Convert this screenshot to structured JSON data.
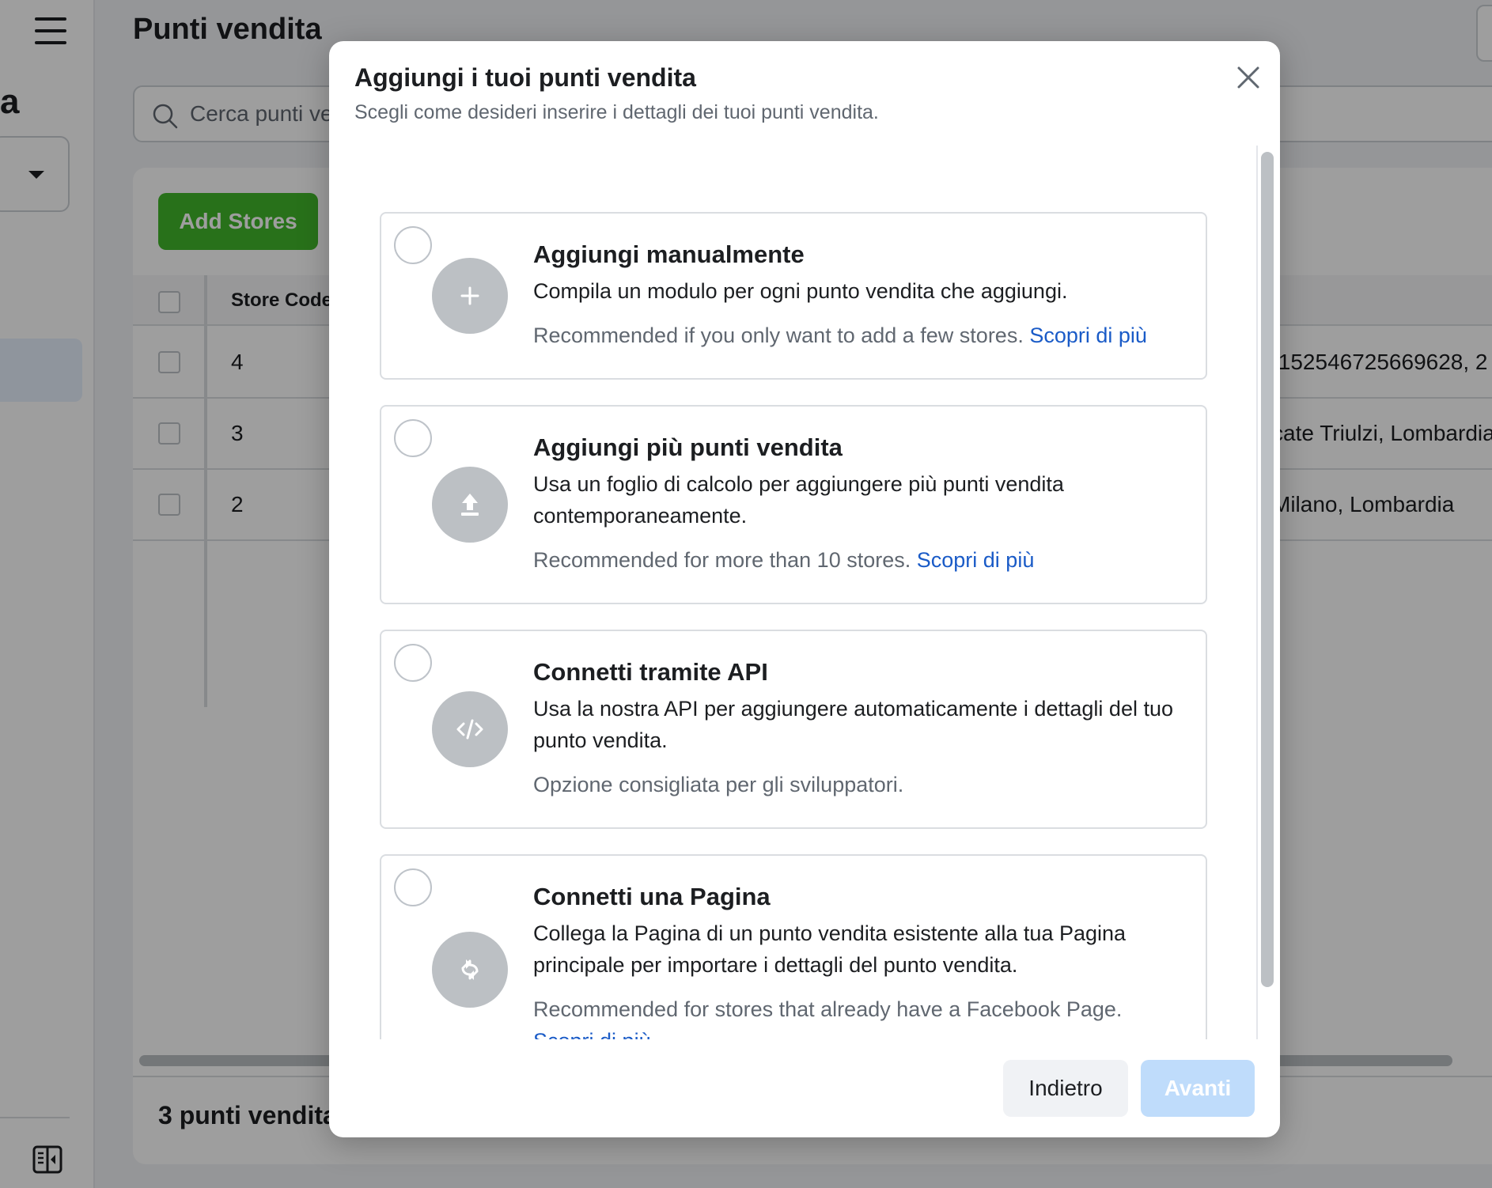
{
  "page": {
    "title": "Punti vendita",
    "search_placeholder": "Cerca punti vendita",
    "sidebar_heading_fragment": "a",
    "add_stores_label": "Add Stores",
    "table": {
      "header_store_code": "Store Code",
      "rows": [
        {
          "code": "4",
          "address": ".152546725669628, 2"
        },
        {
          "code": "3",
          "address": "cate Triulzi, Lombardia"
        },
        {
          "code": "2",
          "address": "Milano, Lombardia"
        }
      ]
    },
    "footer_count": "3 punti vendita"
  },
  "modal": {
    "title": "Aggiungi i tuoi punti vendita",
    "subtitle": "Scegli come desideri inserire i dettagli dei tuoi punti vendita.",
    "options": [
      {
        "icon": "plus-icon",
        "title": "Aggiungi manualmente",
        "description": "Compila un modulo per ogni punto vendita che aggiungi.",
        "note": "Recommended if you only want to add a few stores.",
        "link": "Scopri di più"
      },
      {
        "icon": "upload-icon",
        "title": "Aggiungi più punti vendita",
        "description": "Usa un foglio di calcolo per aggiungere più punti vendita contemporaneamente.",
        "note": "Recommended for more than 10 stores.",
        "link": "Scopri di più"
      },
      {
        "icon": "code-icon",
        "title": "Connetti tramite API",
        "description": "Usa la nostra API per aggiungere automaticamente i dettagli del tuo punto vendita.",
        "note": "Opzione consigliata per gli sviluppatori.",
        "link": ""
      },
      {
        "icon": "sync-icon",
        "title": "Connetti una Pagina",
        "description": "Collega la Pagina di un punto vendita esistente alla tua Pagina principale per importare i dettagli del punto vendita.",
        "note": "Recommended for stores that already have a Facebook Page.",
        "link": "Scopri di più"
      }
    ],
    "back_label": "Indietro",
    "next_label": "Avanti"
  },
  "colors": {
    "primary_green": "#42b72a",
    "link_blue": "#1a5bc7",
    "disabled_blue": "#bfdcfb"
  }
}
